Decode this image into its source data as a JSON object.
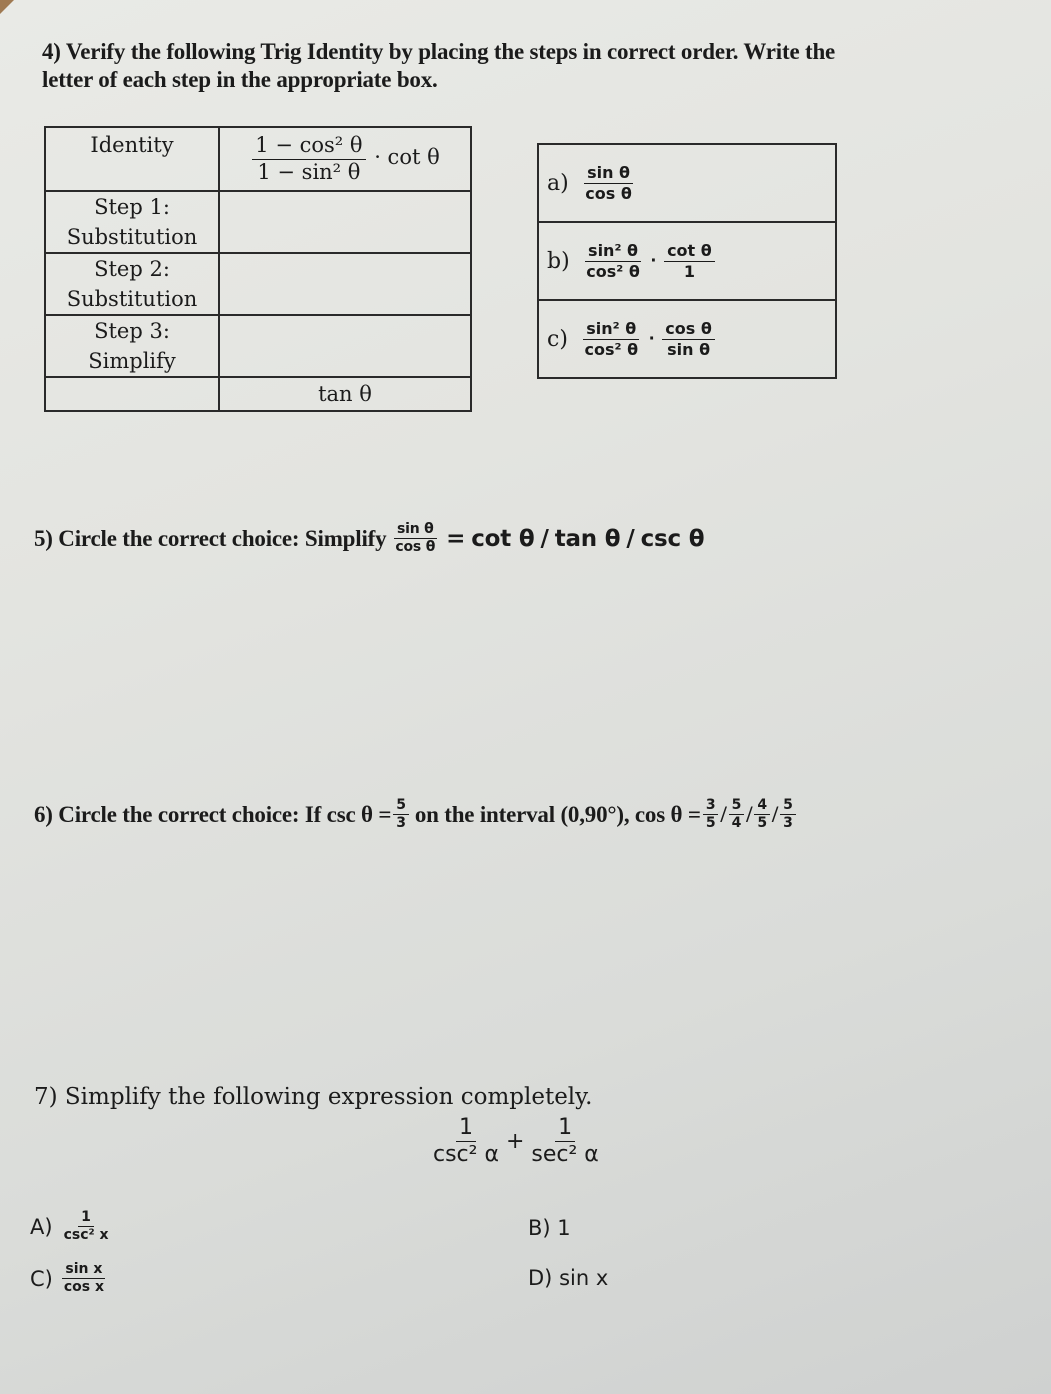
{
  "q4": {
    "title_line1": "4) Verify the following Trig Identity by placing the steps in correct order. Write the",
    "title_line2": "letter of each step in the appropriate box.",
    "table": {
      "identity_label": "Identity",
      "identity_num": "1 − cos² θ",
      "identity_den": "1 − sin² θ",
      "identity_suffix": "· cot θ",
      "rows": [
        {
          "label_line1": "Step 1:",
          "label_line2": "Substitution",
          "answer": ""
        },
        {
          "label_line1": "Step 2:",
          "label_line2": "Substitution",
          "answer": ""
        },
        {
          "label_line1": "Step 3:",
          "label_line2": "Simplify",
          "answer": ""
        }
      ],
      "result": "tan θ"
    },
    "choices": [
      {
        "letter": "a)",
        "num1": "sin θ",
        "den1": "cos θ"
      },
      {
        "letter": "b)",
        "num1": "sin² θ",
        "den1": "cos² θ",
        "num2": "cot θ",
        "den2": "1"
      },
      {
        "letter": "c)",
        "num1": "sin² θ",
        "den1": "cos² θ",
        "num2": "cos θ",
        "den2": "sin θ"
      }
    ]
  },
  "q5": {
    "prefix": "5) Circle the correct choice: Simplify",
    "num": "sin θ",
    "den": "cos θ",
    "eq": "=",
    "options": [
      "cot θ",
      "tan θ",
      "csc θ"
    ],
    "separator": "/"
  },
  "q6": {
    "prefix": "6) Circle the correct choice: If csc θ =",
    "given_num": "5",
    "given_den": "3",
    "middle": "on the interval (0,90°), cos θ =",
    "options": [
      {
        "num": "3",
        "den": "5"
      },
      {
        "num": "5",
        "den": "4"
      },
      {
        "num": "4",
        "den": "5"
      },
      {
        "num": "5",
        "den": "3"
      }
    ],
    "separator": "/"
  },
  "q7": {
    "title": "7) Simplify the following expression completely.",
    "term1_num": "1",
    "term1_den": "csc² α",
    "plus": "+",
    "term2_num": "1",
    "term2_den": "sec² α",
    "answers": {
      "A": {
        "label": "A)",
        "num": "1",
        "den": "csc² x"
      },
      "B": {
        "label": "B)",
        "value": "1"
      },
      "C": {
        "label": "C)",
        "num": "sin x",
        "den": "cos x"
      },
      "D": {
        "label": "D)",
        "value": "sin x"
      }
    }
  }
}
